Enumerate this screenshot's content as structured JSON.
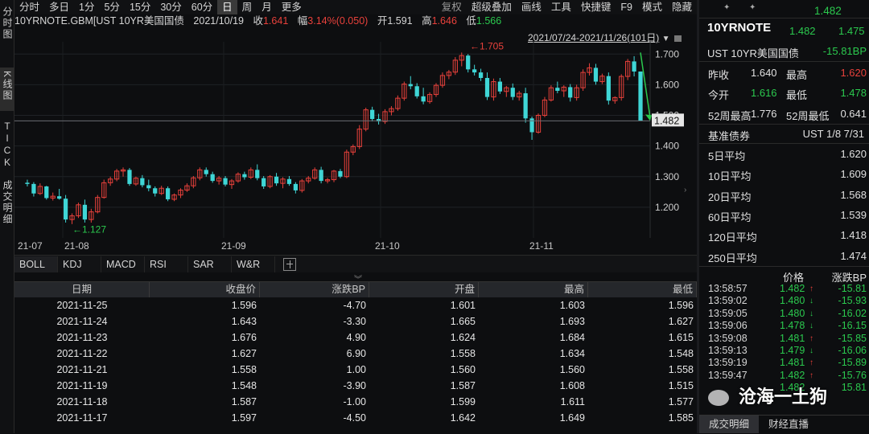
{
  "side_tabs": [
    "分时图",
    "K线图",
    "TICK",
    "成交明细"
  ],
  "toolbar": {
    "periods": [
      "分时",
      "多日",
      "1分",
      "5分",
      "15分",
      "30分",
      "60分",
      "日",
      "周",
      "月",
      "更多"
    ],
    "active_period": "日",
    "right": [
      "复权",
      "超级叠加",
      "画线",
      "工具",
      "快捷键",
      "F9",
      "模式",
      "隐藏"
    ]
  },
  "infobar": {
    "symbol": "10YRNOTE.GBM[UST 10YR美国国债",
    "date": "2021/10/19",
    "close_label": "收",
    "close": "1.641",
    "change_label": "幅",
    "change": "3.14%(0.050)",
    "open_label": "开",
    "open": "1.591",
    "high_label": "高",
    "high": "1.646",
    "low_label": "低",
    "low": "1.566"
  },
  "chart_range": "2021/07/24-2021/11/26(101日)",
  "chart_data": {
    "type": "candlestick",
    "x_labels": [
      "21-07",
      "21-08",
      "21-09",
      "21-10",
      "21-11"
    ],
    "y_ticks": [
      1.7,
      1.6,
      1.5,
      1.4,
      1.3,
      1.2
    ],
    "ylim": [
      1.1,
      1.74
    ],
    "price_axis_labels": [
      "1.700",
      "1.600",
      "1.500",
      "1.400",
      "1.300",
      "1.200"
    ],
    "last_price": "1.482",
    "high_annotation": "←1.705",
    "low_annotation": "←1.127",
    "candles": [
      {
        "o": 1.28,
        "h": 1.29,
        "l": 1.268,
        "c": 1.276
      },
      {
        "o": 1.276,
        "h": 1.282,
        "l": 1.235,
        "c": 1.245
      },
      {
        "o": 1.245,
        "h": 1.278,
        "l": 1.24,
        "c": 1.268
      },
      {
        "o": 1.268,
        "h": 1.27,
        "l": 1.225,
        "c": 1.23
      },
      {
        "o": 1.23,
        "h": 1.248,
        "l": 1.222,
        "c": 1.236
      },
      {
        "o": 1.236,
        "h": 1.26,
        "l": 1.225,
        "c": 1.228
      },
      {
        "o": 1.228,
        "h": 1.24,
        "l": 1.15,
        "c": 1.16
      },
      {
        "o": 1.16,
        "h": 1.18,
        "l": 1.145,
        "c": 1.172
      },
      {
        "o": 1.172,
        "h": 1.215,
        "l": 1.165,
        "c": 1.208
      },
      {
        "o": 1.208,
        "h": 1.225,
        "l": 1.15,
        "c": 1.16
      },
      {
        "o": 1.16,
        "h": 1.195,
        "l": 1.15,
        "c": 1.185
      },
      {
        "o": 1.185,
        "h": 1.24,
        "l": 1.18,
        "c": 1.232
      },
      {
        "o": 1.232,
        "h": 1.29,
        "l": 1.228,
        "c": 1.28
      },
      {
        "o": 1.28,
        "h": 1.3,
        "l": 1.27,
        "c": 1.292
      },
      {
        "o": 1.292,
        "h": 1.325,
        "l": 1.285,
        "c": 1.318
      },
      {
        "o": 1.318,
        "h": 1.33,
        "l": 1.3,
        "c": 1.322
      },
      {
        "o": 1.322,
        "h": 1.328,
        "l": 1.27,
        "c": 1.276
      },
      {
        "o": 1.276,
        "h": 1.3,
        "l": 1.27,
        "c": 1.295
      },
      {
        "o": 1.295,
        "h": 1.305,
        "l": 1.265,
        "c": 1.272
      },
      {
        "o": 1.272,
        "h": 1.29,
        "l": 1.252,
        "c": 1.262
      },
      {
        "o": 1.262,
        "h": 1.268,
        "l": 1.235,
        "c": 1.245
      },
      {
        "o": 1.245,
        "h": 1.27,
        "l": 1.24,
        "c": 1.262
      },
      {
        "o": 1.262,
        "h": 1.268,
        "l": 1.22,
        "c": 1.226
      },
      {
        "o": 1.226,
        "h": 1.245,
        "l": 1.22,
        "c": 1.24
      },
      {
        "o": 1.24,
        "h": 1.262,
        "l": 1.23,
        "c": 1.256
      },
      {
        "o": 1.256,
        "h": 1.278,
        "l": 1.25,
        "c": 1.27
      },
      {
        "o": 1.27,
        "h": 1.302,
        "l": 1.262,
        "c": 1.296
      },
      {
        "o": 1.296,
        "h": 1.33,
        "l": 1.288,
        "c": 1.322
      },
      {
        "o": 1.322,
        "h": 1.33,
        "l": 1.3,
        "c": 1.308
      },
      {
        "o": 1.308,
        "h": 1.316,
        "l": 1.28,
        "c": 1.286
      },
      {
        "o": 1.286,
        "h": 1.302,
        "l": 1.274,
        "c": 1.295
      },
      {
        "o": 1.295,
        "h": 1.302,
        "l": 1.268,
        "c": 1.274
      },
      {
        "o": 1.274,
        "h": 1.292,
        "l": 1.26,
        "c": 1.286
      },
      {
        "o": 1.286,
        "h": 1.314,
        "l": 1.28,
        "c": 1.308
      },
      {
        "o": 1.308,
        "h": 1.316,
        "l": 1.29,
        "c": 1.298
      },
      {
        "o": 1.298,
        "h": 1.33,
        "l": 1.292,
        "c": 1.322
      },
      {
        "o": 1.322,
        "h": 1.34,
        "l": 1.288,
        "c": 1.295
      },
      {
        "o": 1.295,
        "h": 1.302,
        "l": 1.26,
        "c": 1.268
      },
      {
        "o": 1.268,
        "h": 1.305,
        "l": 1.262,
        "c": 1.3
      },
      {
        "o": 1.3,
        "h": 1.312,
        "l": 1.27,
        "c": 1.278
      },
      {
        "o": 1.278,
        "h": 1.298,
        "l": 1.262,
        "c": 1.292
      },
      {
        "o": 1.292,
        "h": 1.302,
        "l": 1.27,
        "c": 1.276
      },
      {
        "o": 1.276,
        "h": 1.282,
        "l": 1.245,
        "c": 1.255
      },
      {
        "o": 1.255,
        "h": 1.292,
        "l": 1.248,
        "c": 1.286
      },
      {
        "o": 1.286,
        "h": 1.302,
        "l": 1.278,
        "c": 1.295
      },
      {
        "o": 1.295,
        "h": 1.33,
        "l": 1.29,
        "c": 1.322
      },
      {
        "o": 1.322,
        "h": 1.332,
        "l": 1.278,
        "c": 1.286
      },
      {
        "o": 1.286,
        "h": 1.296,
        "l": 1.278,
        "c": 1.29
      },
      {
        "o": 1.29,
        "h": 1.322,
        "l": 1.282,
        "c": 1.318
      },
      {
        "o": 1.318,
        "h": 1.325,
        "l": 1.295,
        "c": 1.3
      },
      {
        "o": 1.3,
        "h": 1.388,
        "l": 1.295,
        "c": 1.38
      },
      {
        "o": 1.38,
        "h": 1.405,
        "l": 1.37,
        "c": 1.398
      },
      {
        "o": 1.398,
        "h": 1.468,
        "l": 1.39,
        "c": 1.455
      },
      {
        "o": 1.455,
        "h": 1.525,
        "l": 1.448,
        "c": 1.518
      },
      {
        "o": 1.518,
        "h": 1.528,
        "l": 1.48,
        "c": 1.488
      },
      {
        "o": 1.488,
        "h": 1.505,
        "l": 1.47,
        "c": 1.48
      },
      {
        "o": 1.48,
        "h": 1.52,
        "l": 1.472,
        "c": 1.512
      },
      {
        "o": 1.512,
        "h": 1.53,
        "l": 1.5,
        "c": 1.522
      },
      {
        "o": 1.522,
        "h": 1.565,
        "l": 1.515,
        "c": 1.556
      },
      {
        "o": 1.556,
        "h": 1.61,
        "l": 1.548,
        "c": 1.602
      },
      {
        "o": 1.602,
        "h": 1.628,
        "l": 1.585,
        "c": 1.595
      },
      {
        "o": 1.595,
        "h": 1.605,
        "l": 1.555,
        "c": 1.562
      },
      {
        "o": 1.562,
        "h": 1.59,
        "l": 1.536,
        "c": 1.545
      },
      {
        "o": 1.545,
        "h": 1.575,
        "l": 1.538,
        "c": 1.568
      },
      {
        "o": 1.568,
        "h": 1.605,
        "l": 1.56,
        "c": 1.598
      },
      {
        "o": 1.598,
        "h": 1.64,
        "l": 1.59,
        "c": 1.63
      },
      {
        "o": 1.63,
        "h": 1.648,
        "l": 1.618,
        "c": 1.641
      },
      {
        "o": 1.641,
        "h": 1.69,
        "l": 1.632,
        "c": 1.68
      },
      {
        "o": 1.68,
        "h": 1.705,
        "l": 1.66,
        "c": 1.695
      },
      {
        "o": 1.695,
        "h": 1.7,
        "l": 1.64,
        "c": 1.65
      },
      {
        "o": 1.65,
        "h": 1.665,
        "l": 1.63,
        "c": 1.64
      },
      {
        "o": 1.64,
        "h": 1.652,
        "l": 1.612,
        "c": 1.622
      },
      {
        "o": 1.622,
        "h": 1.64,
        "l": 1.55,
        "c": 1.56
      },
      {
        "o": 1.56,
        "h": 1.62,
        "l": 1.548,
        "c": 1.61
      },
      {
        "o": 1.61,
        "h": 1.622,
        "l": 1.57,
        "c": 1.578
      },
      {
        "o": 1.578,
        "h": 1.596,
        "l": 1.56,
        "c": 1.59
      },
      {
        "o": 1.59,
        "h": 1.604,
        "l": 1.55,
        "c": 1.56
      },
      {
        "o": 1.56,
        "h": 1.58,
        "l": 1.548,
        "c": 1.572
      },
      {
        "o": 1.572,
        "h": 1.59,
        "l": 1.476,
        "c": 1.49
      },
      {
        "o": 1.49,
        "h": 1.496,
        "l": 1.42,
        "c": 1.445
      },
      {
        "o": 1.445,
        "h": 1.506,
        "l": 1.44,
        "c": 1.5
      },
      {
        "o": 1.5,
        "h": 1.56,
        "l": 1.494,
        "c": 1.55
      },
      {
        "o": 1.55,
        "h": 1.598,
        "l": 1.545,
        "c": 1.59
      },
      {
        "o": 1.59,
        "h": 1.61,
        "l": 1.572,
        "c": 1.58
      },
      {
        "o": 1.58,
        "h": 1.598,
        "l": 1.56,
        "c": 1.592
      },
      {
        "o": 1.592,
        "h": 1.602,
        "l": 1.545,
        "c": 1.558
      },
      {
        "o": 1.558,
        "h": 1.6,
        "l": 1.548,
        "c": 1.59
      },
      {
        "o": 1.59,
        "h": 1.65,
        "l": 1.58,
        "c": 1.64
      },
      {
        "o": 1.64,
        "h": 1.67,
        "l": 1.63,
        "c": 1.655
      },
      {
        "o": 1.655,
        "h": 1.668,
        "l": 1.6,
        "c": 1.61
      },
      {
        "o": 1.61,
        "h": 1.636,
        "l": 1.602,
        "c": 1.628
      },
      {
        "o": 1.628,
        "h": 1.64,
        "l": 1.535,
        "c": 1.548
      },
      {
        "o": 1.548,
        "h": 1.562,
        "l": 1.538,
        "c": 1.558
      },
      {
        "o": 1.558,
        "h": 1.634,
        "l": 1.548,
        "c": 1.627
      },
      {
        "o": 1.627,
        "h": 1.684,
        "l": 1.615,
        "c": 1.676
      },
      {
        "o": 1.676,
        "h": 1.693,
        "l": 1.627,
        "c": 1.643
      },
      {
        "o": 1.643,
        "h": 1.603,
        "l": 1.482,
        "c": 1.482
      }
    ]
  },
  "indicators": [
    "BOLL",
    "KDJ",
    "MACD",
    "RSI",
    "SAR",
    "W&R"
  ],
  "table": {
    "headers": [
      "日期",
      "收盘价",
      "涨跌BP",
      "开盘",
      "最高",
      "最低"
    ],
    "rows": [
      [
        "2021-11-25",
        "1.596",
        "-4.70",
        "1.601",
        "1.603",
        "1.596"
      ],
      [
        "2021-11-24",
        "1.643",
        "-3.30",
        "1.665",
        "1.693",
        "1.627"
      ],
      [
        "2021-11-23",
        "1.676",
        "4.90",
        "1.624",
        "1.684",
        "1.615"
      ],
      [
        "2021-11-22",
        "1.627",
        "6.90",
        "1.558",
        "1.634",
        "1.548"
      ],
      [
        "2021-11-21",
        "1.558",
        "1.00",
        "1.560",
        "1.560",
        "1.558"
      ],
      [
        "2021-11-19",
        "1.548",
        "-3.90",
        "1.587",
        "1.608",
        "1.515"
      ],
      [
        "2021-11-18",
        "1.587",
        "-1.00",
        "1.599",
        "1.611",
        "1.577"
      ],
      [
        "2021-11-17",
        "1.597",
        "-4.50",
        "1.642",
        "1.649",
        "1.585"
      ]
    ]
  },
  "right_panel": {
    "top_price": "1.482",
    "symbol": "10YRNOTE",
    "bid": "1.482",
    "ask": "1.475",
    "name": "UST 10YR美国国债",
    "change_bp": "-15.81BP",
    "prev_close_label": "昨收",
    "prev_close": "1.640",
    "high_label": "最高",
    "high": "1.620",
    "open_label": "今开",
    "open": "1.616",
    "low_label": "最低",
    "low": "1.478",
    "w52_high_label": "52周最高",
    "w52_high": "1.776",
    "w52_low_label": "52周最低",
    "w52_low": "0.641",
    "bench_label": "基准债券",
    "bench_value": "UST 1/8 7/31",
    "averages": [
      {
        "label": "5日平均",
        "value": "1.620"
      },
      {
        "label": "10日平均",
        "value": "1.609"
      },
      {
        "label": "20日平均",
        "value": "1.568"
      },
      {
        "label": "60日平均",
        "value": "1.539"
      },
      {
        "label": "120日平均",
        "value": "1.418"
      },
      {
        "label": "250日平均",
        "value": "1.474"
      }
    ],
    "trade_headers": [
      "价格",
      "涨跌BP"
    ],
    "trades": [
      {
        "time": "13:58:57",
        "price": "1.482",
        "dir": "up",
        "bp": "-15.81"
      },
      {
        "time": "13:59:02",
        "price": "1.480",
        "dir": "down",
        "bp": "-15.93"
      },
      {
        "time": "13:59:05",
        "price": "1.480",
        "dir": "down",
        "bp": "-16.02"
      },
      {
        "time": "13:59:06",
        "price": "1.478",
        "dir": "down",
        "bp": "-16.15"
      },
      {
        "time": "13:59:08",
        "price": "1.481",
        "dir": "up",
        "bp": "-15.85"
      },
      {
        "time": "13:59:13",
        "price": "1.479",
        "dir": "down",
        "bp": "-16.06"
      },
      {
        "time": "13:59:19",
        "price": "1.481",
        "dir": "up",
        "bp": "-15.89"
      },
      {
        "time": "13:59:47",
        "price": "1.482",
        "dir": "up",
        "bp": "-15.76"
      },
      {
        "time": "",
        "price": "1.482",
        "dir": "",
        "bp": "15.81"
      }
    ],
    "tabs": [
      "成交明细",
      "财经直播"
    ]
  },
  "watermark": "沧海一土狗",
  "colors": {
    "up": "#e8413b",
    "down": "#3fd6d6",
    "green": "#2bc94e",
    "bg": "#0d0e10"
  }
}
